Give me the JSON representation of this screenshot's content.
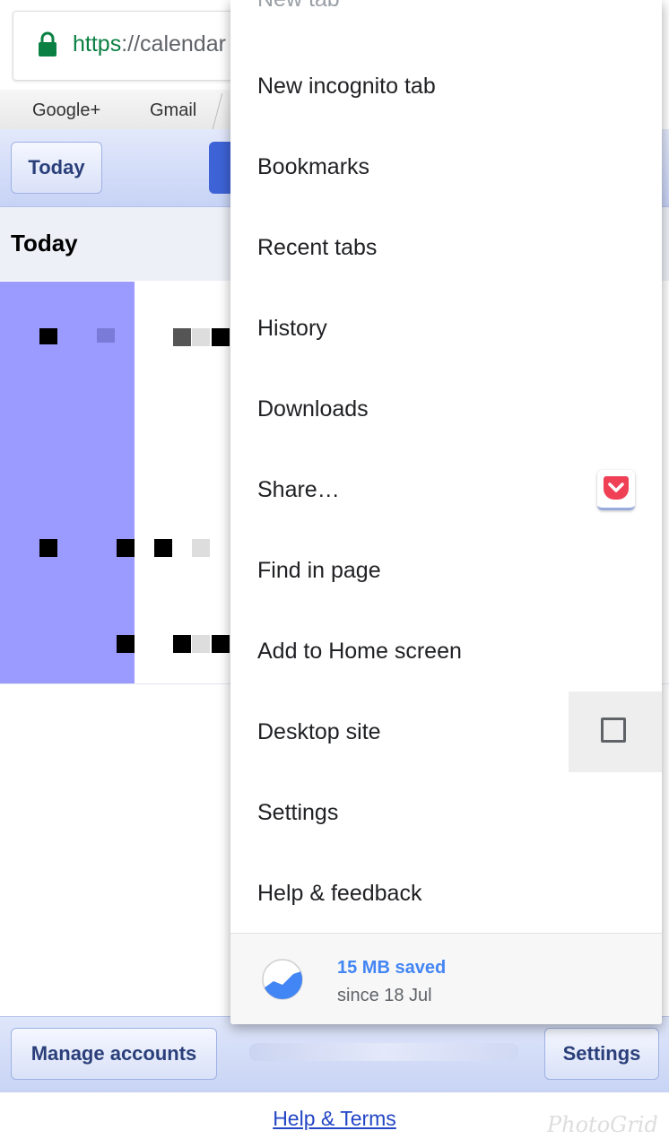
{
  "browser": {
    "url_scheme": "https",
    "url_rest": "://calendar",
    "bookmark_tabs": [
      "Google+",
      "Gmail"
    ]
  },
  "calendar": {
    "today_button": "Today",
    "today_heading": "Today",
    "manage_accounts": "Manage accounts",
    "settings": "Settings",
    "help_terms": "Help & Terms"
  },
  "menu": {
    "partial_item": "New tab",
    "items": [
      "New incognito tab",
      "Bookmarks",
      "Recent tabs",
      "History",
      "Downloads",
      "Share…",
      "Find in page",
      "Add to Home screen",
      "Desktop site",
      "Settings",
      "Help & feedback"
    ],
    "desktop_site_checked": false,
    "data_saver": {
      "saved": "15 MB saved",
      "since": "since 18 Jul"
    }
  },
  "watermark": "PhotoGrid",
  "colors": {
    "accent_blue": "#4285f4",
    "event_purple": "#9b9bff",
    "lock_green": "#0b8043"
  }
}
